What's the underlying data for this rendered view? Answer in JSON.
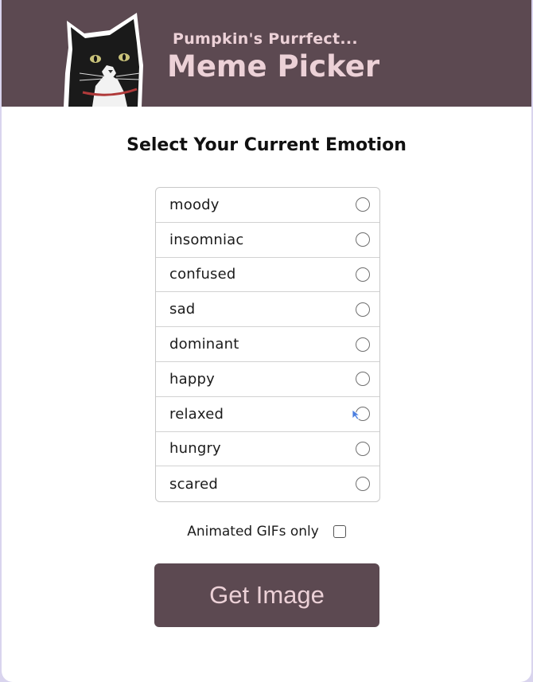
{
  "header": {
    "subtitle": "Pumpkin's Purrfect...",
    "title": "Meme Picker"
  },
  "prompt": "Select Your Current Emotion",
  "emotions": [
    {
      "label": "moody",
      "selected": false
    },
    {
      "label": "insomniac",
      "selected": false
    },
    {
      "label": "confused",
      "selected": false
    },
    {
      "label": "sad",
      "selected": false
    },
    {
      "label": "dominant",
      "selected": false
    },
    {
      "label": "happy",
      "selected": false
    },
    {
      "label": "relaxed",
      "selected": false
    },
    {
      "label": "hungry",
      "selected": false
    },
    {
      "label": "scared",
      "selected": false
    }
  ],
  "gif_option": {
    "label": "Animated GIFs only",
    "checked": false
  },
  "action": {
    "label": "Get Image"
  },
  "colors": {
    "header_bg": "#5c4951",
    "header_text": "#ecd1d7",
    "button_bg": "#5c4951",
    "button_text": "#ecd1d7"
  },
  "icons": {
    "logo": "cat-icon",
    "cursor": "mouse-pointer-icon"
  }
}
